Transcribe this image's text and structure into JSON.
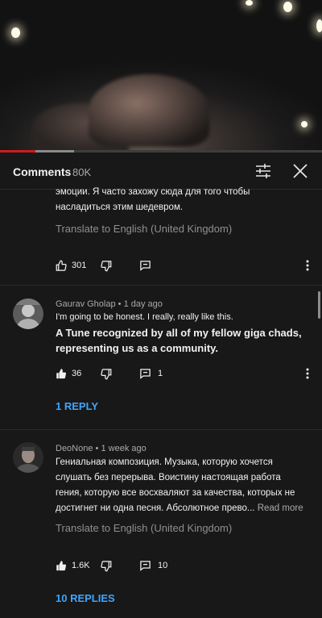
{
  "panel": {
    "title": "Comments",
    "count": "80K"
  },
  "comments": [
    {
      "text_lines": [
        "эмоции. Я часто захожу сюда для того чтобы",
        "насладиться этим шедевром."
      ],
      "translate": "Translate to English (United Kingdom)",
      "likes": "301",
      "replies_count": ""
    },
    {
      "author": "Gaurav Gholap",
      "time": "1 day ago",
      "text_small": "I'm going to be honest. I really, really like this.",
      "text_bold_lines": [
        "A Tune recognized by all of my fellow giga chads,",
        "representing us as a community."
      ],
      "likes": "36",
      "replies_count": "1",
      "replies_link": "1 REPLY"
    },
    {
      "author": "DeoNone",
      "time": "1 week ago",
      "text_lines": [
        "Гениальная композиция. Музыка, которую хочется",
        "слушать без перерыва. Воистину настоящая работа",
        "гения, которую все восхваляют за качества, которых не",
        "достигнет ни одна песня. Абсолютное прево..."
      ],
      "read_more": "Read more",
      "translate": "Translate to English (United Kingdom)",
      "likes": "1.6K",
      "replies_count": "10",
      "replies_link": "10 REPLIES"
    }
  ],
  "icons": {
    "filter": "tune-filter-icon",
    "close": "close-icon",
    "like": "thumb-up-icon",
    "dislike": "thumb-down-icon",
    "reply": "reply-comment-icon",
    "more": "more-vert-icon"
  },
  "colors": {
    "background": "#181818",
    "progress_played": "#cc1d1d",
    "link": "#3ea6ff"
  },
  "video": {
    "progress_fraction": 0.11,
    "buffered_fraction": 0.23
  },
  "sep": "•"
}
